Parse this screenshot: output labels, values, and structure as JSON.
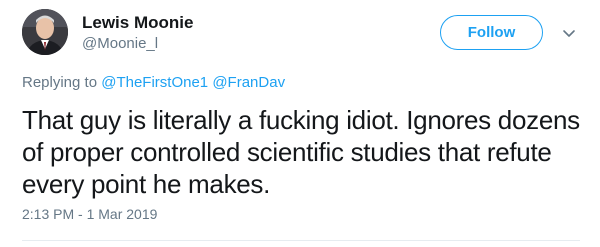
{
  "author": {
    "display_name": "Lewis Moonie",
    "handle": "@Moonie_l"
  },
  "actions": {
    "follow_label": "Follow"
  },
  "reply_context": {
    "prefix": "Replying to",
    "mentions": [
      "@TheFirstOne1",
      "@FranDav"
    ]
  },
  "tweet": {
    "text": "That guy is literally a fucking idiot. Ignores dozens of proper controlled scientific studies that refute every point he makes.",
    "timestamp": "2:13 PM - 1 Mar 2019"
  },
  "icons": {
    "avatar": "profile-photo",
    "menu": "chevron-down-icon"
  },
  "colors": {
    "accent": "#1da1f2",
    "text_primary": "#14171a",
    "text_secondary": "#657786",
    "divider": "#e6ecf0"
  }
}
